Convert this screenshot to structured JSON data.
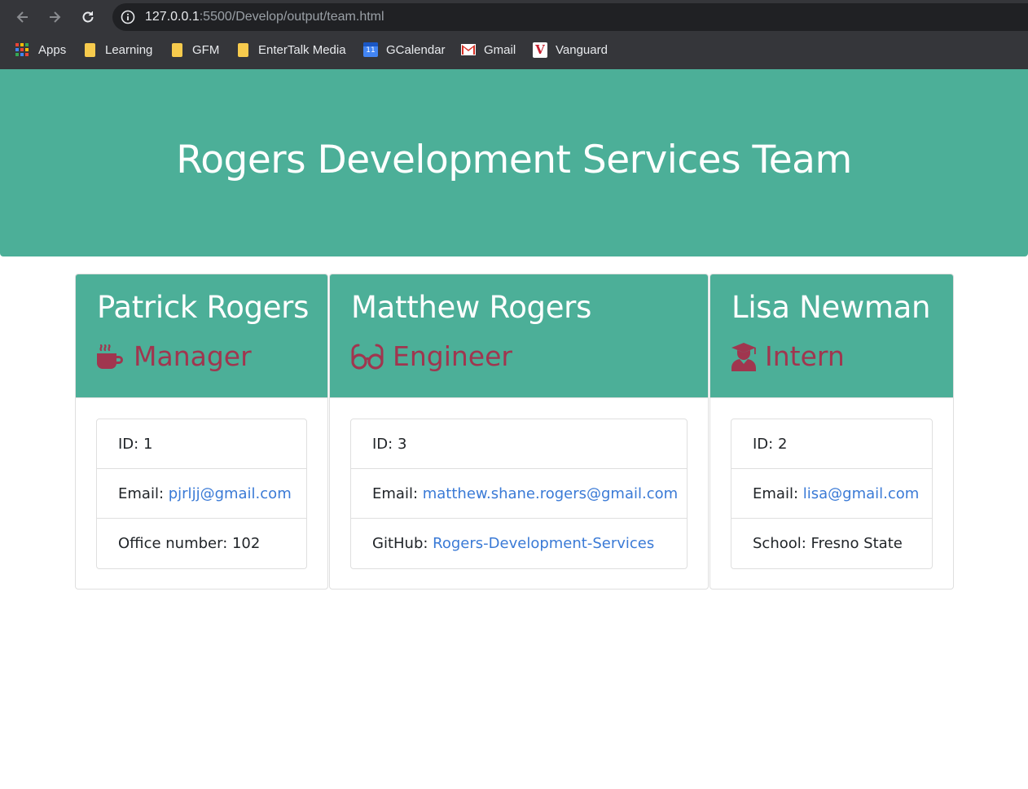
{
  "browser": {
    "url_host": "127.0.0.1",
    "url_rest": ":5500/Develop/output/team.html",
    "bookmarks": [
      {
        "label": "Apps",
        "icon": "apps-grid-icon"
      },
      {
        "label": "Learning",
        "icon": "folder-icon"
      },
      {
        "label": "GFM",
        "icon": "folder-icon"
      },
      {
        "label": "EnterTalk Media",
        "icon": "folder-icon"
      },
      {
        "label": "GCalendar",
        "icon": "calendar-icon",
        "day": "11"
      },
      {
        "label": "Gmail",
        "icon": "gmail-icon"
      },
      {
        "label": "Vanguard",
        "icon": "vanguard-icon",
        "glyph": "V"
      }
    ]
  },
  "page": {
    "title": "Rogers Development Services Team",
    "colors": {
      "header_bg": "#4caf98",
      "role_text": "#a0364f",
      "link": "#3a7ad6"
    }
  },
  "team": [
    {
      "name": "Patrick Rogers",
      "role": "Manager",
      "role_icon": "mug-hot-icon",
      "id_text": "ID: 1",
      "email_label": "Email: ",
      "email": "pjrljj@gmail.com",
      "extra_label": "Office number: 102",
      "extra_link": ""
    },
    {
      "name": "Matthew Rogers",
      "role": "Engineer",
      "role_icon": "glasses-icon",
      "id_text": "ID: 3",
      "email_label": "Email: ",
      "email": "matthew.shane.rogers@gmail.com",
      "extra_label": "GitHub: ",
      "extra_link": "Rogers-Development-Services"
    },
    {
      "name": "Lisa Newman",
      "role": "Intern",
      "role_icon": "user-graduate-icon",
      "id_text": "ID: 2",
      "email_label": "Email: ",
      "email": "lisa@gmail.com",
      "extra_label": "School: Fresno State",
      "extra_link": ""
    }
  ]
}
